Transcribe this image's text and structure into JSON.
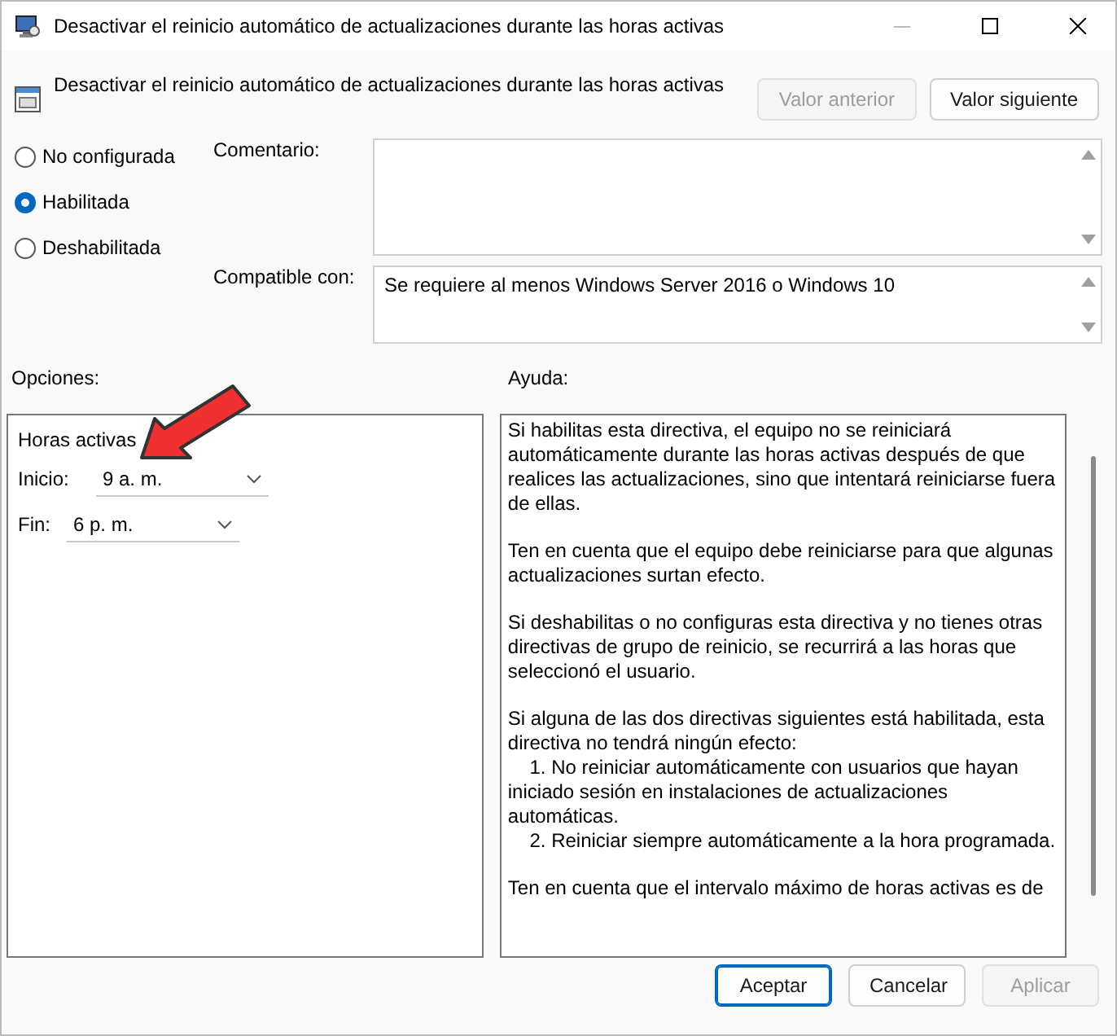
{
  "window": {
    "title": "Desactivar el reinicio automático de actualizaciones durante las horas activas"
  },
  "header": {
    "title": "Desactivar el reinicio automático de actualizaciones durante las horas activas",
    "buttons": [
      {
        "label": "Valor anterior",
        "disabled": true
      },
      {
        "label": "Valor siguiente",
        "disabled": false
      }
    ]
  },
  "state_options": [
    {
      "label": "No configurada",
      "selected": false
    },
    {
      "label": "Habilitada",
      "selected": true
    },
    {
      "label": "Deshabilitada",
      "selected": false
    }
  ],
  "comment": {
    "label": "Comentario:"
  },
  "supported_on": {
    "label": "Compatible con:",
    "value": "Se requiere al menos Windows Server 2016 o Windows 10"
  },
  "options": {
    "label": "Opciones:",
    "group_title": "Horas activas",
    "fields": [
      {
        "label": "Inicio:",
        "value": "9 a. m."
      },
      {
        "label": "Fin:",
        "value": "6 p. m."
      }
    ]
  },
  "help": {
    "label": "Ayuda:",
    "paragraphs": [
      "Si habilitas esta directiva, el equipo no se reiniciará automáticamente durante las horas activas después de que realices las actualizaciones, sino que intentará reiniciarse fuera de ellas.",
      "Ten en cuenta que el equipo debe reiniciarse para que algunas actualizaciones surtan efecto.",
      "Si deshabilitas o no configuras esta directiva y no tienes otras directivas de grupo de reinicio, se recurrirá a las horas que seleccionó el usuario.",
      "Si alguna de las dos directivas siguientes está habilitada, esta directiva no tendrá ningún efecto:\n    1. No reiniciar automáticamente con usuarios que hayan iniciado sesión en instalaciones de actualizaciones automáticas.\n    2. Reiniciar siempre automáticamente a la hora programada.",
      "Ten en cuenta que el intervalo máximo de horas activas es de"
    ]
  },
  "footer": {
    "buttons": [
      {
        "label": "Aceptar",
        "disabled": false,
        "default": true
      },
      {
        "label": "Cancelar",
        "disabled": false,
        "default": false
      },
      {
        "label": "Aplicar",
        "disabled": true,
        "default": false
      }
    ]
  }
}
